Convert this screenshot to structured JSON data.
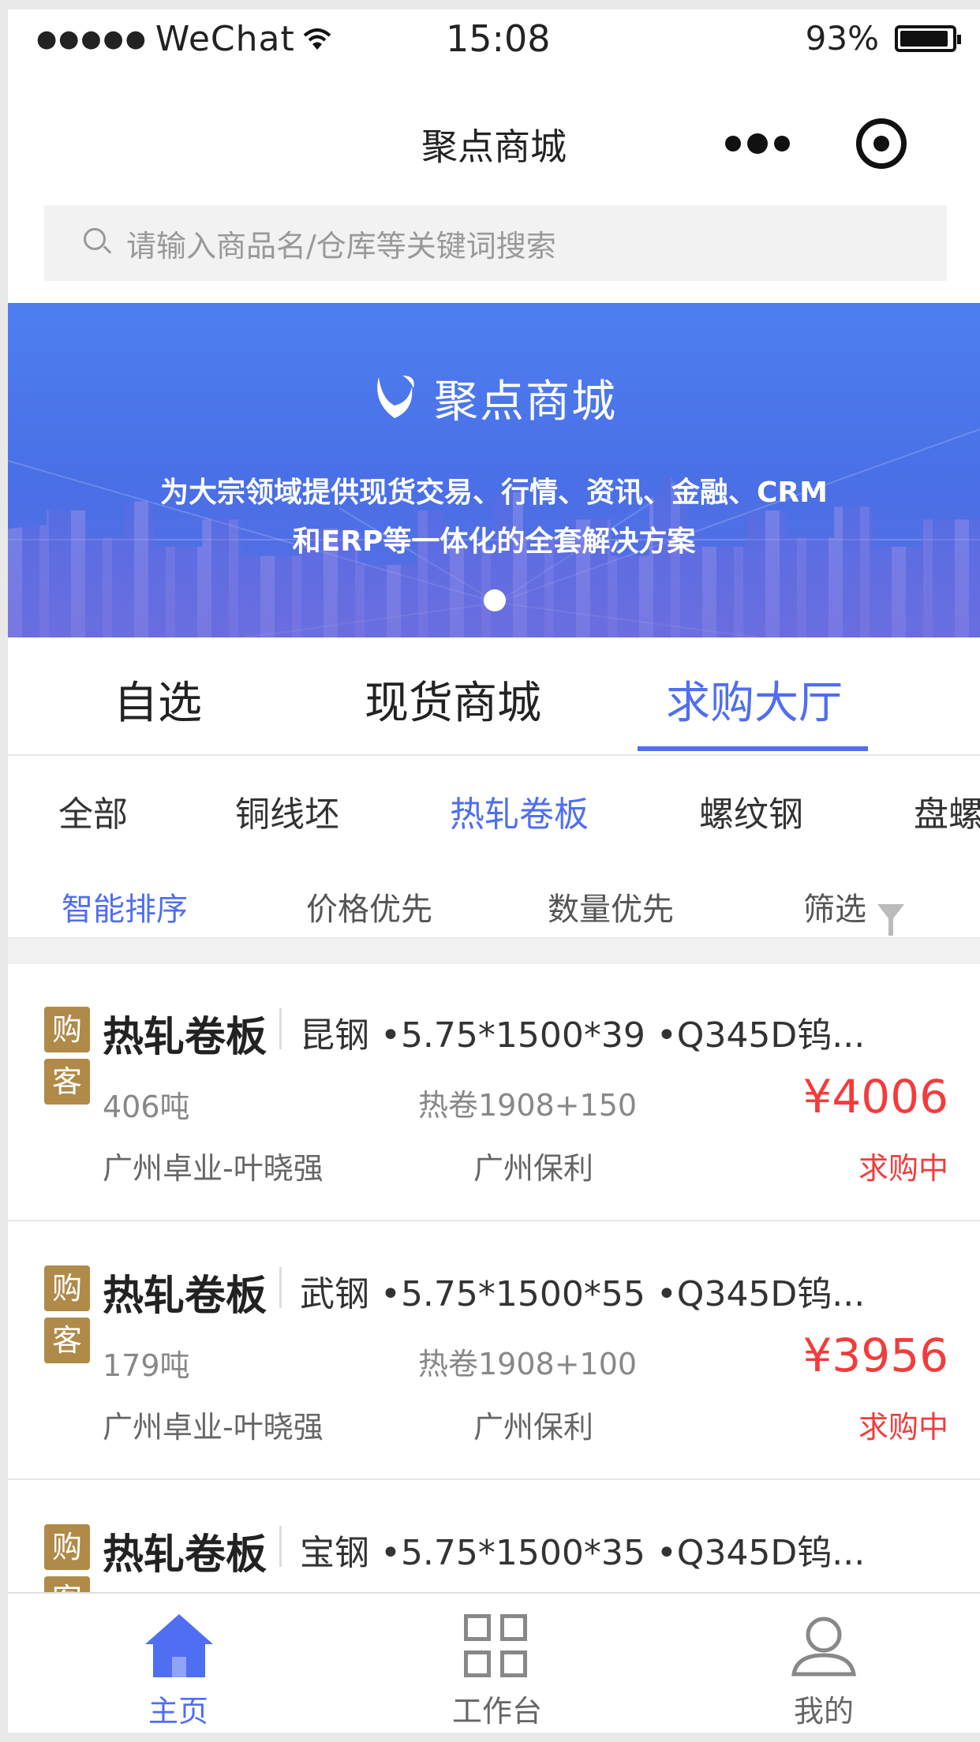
{
  "status_bar": {
    "carrier": "WeChat",
    "time": "15:08",
    "battery": "93%"
  },
  "nav": {
    "title": "聚点商城"
  },
  "search": {
    "placeholder": "请输入商品名/仓库等关键词搜索"
  },
  "banner": {
    "brand": "聚点商城",
    "slogan_line1": "为大宗领域提供现货交易、行情、资讯、金融、CRM",
    "slogan_line2": "和ERP等一体化的全套解决方案"
  },
  "tabs": [
    {
      "label": "自选",
      "active": false
    },
    {
      "label": "现货商城",
      "active": false
    },
    {
      "label": "求购大厅",
      "active": true
    }
  ],
  "categories": [
    {
      "label": "全部",
      "active": false
    },
    {
      "label": "铜线坯",
      "active": false
    },
    {
      "label": "热轧卷板",
      "active": true
    },
    {
      "label": "螺纹钢",
      "active": false
    },
    {
      "label": "盘螺",
      "active": false
    }
  ],
  "sort": [
    {
      "label": "智能排序",
      "active": true
    },
    {
      "label": "价格优先",
      "active": false
    },
    {
      "label": "数量优先",
      "active": false
    },
    {
      "label": "筛选",
      "active": false
    }
  ],
  "badge": {
    "char1": "购",
    "char2": "客"
  },
  "items": [
    {
      "title": "热轧卷板",
      "spec": "昆钢 •5.75*1500*39 •Q345D钨...",
      "qty": "406吨",
      "mid": "热卷1908+150",
      "price": "¥4006",
      "company": "广州卓业-叶晓强",
      "warehouse": "广州保利",
      "status": "求购中"
    },
    {
      "title": "热轧卷板",
      "spec": "武钢 •5.75*1500*55 •Q345D钨...",
      "qty": "179吨",
      "mid": "热卷1908+100",
      "price": "¥3956",
      "company": "广州卓业-叶晓强",
      "warehouse": "广州保利",
      "status": "求购中"
    },
    {
      "title": "热轧卷板",
      "spec": "宝钢 •5.75*1500*35 •Q345D钨...",
      "qty": "",
      "mid": "",
      "price": "",
      "company": "",
      "warehouse": "",
      "status": ""
    }
  ],
  "tabbar": [
    {
      "label": "主页",
      "icon": "home-icon",
      "active": true
    },
    {
      "label": "工作台",
      "icon": "grid-icon",
      "active": false
    },
    {
      "label": "我的",
      "icon": "user-icon",
      "active": false
    }
  ],
  "colors": {
    "accent": "#4f6ef2",
    "price": "#f23c3c",
    "badge": "#b08a48"
  }
}
